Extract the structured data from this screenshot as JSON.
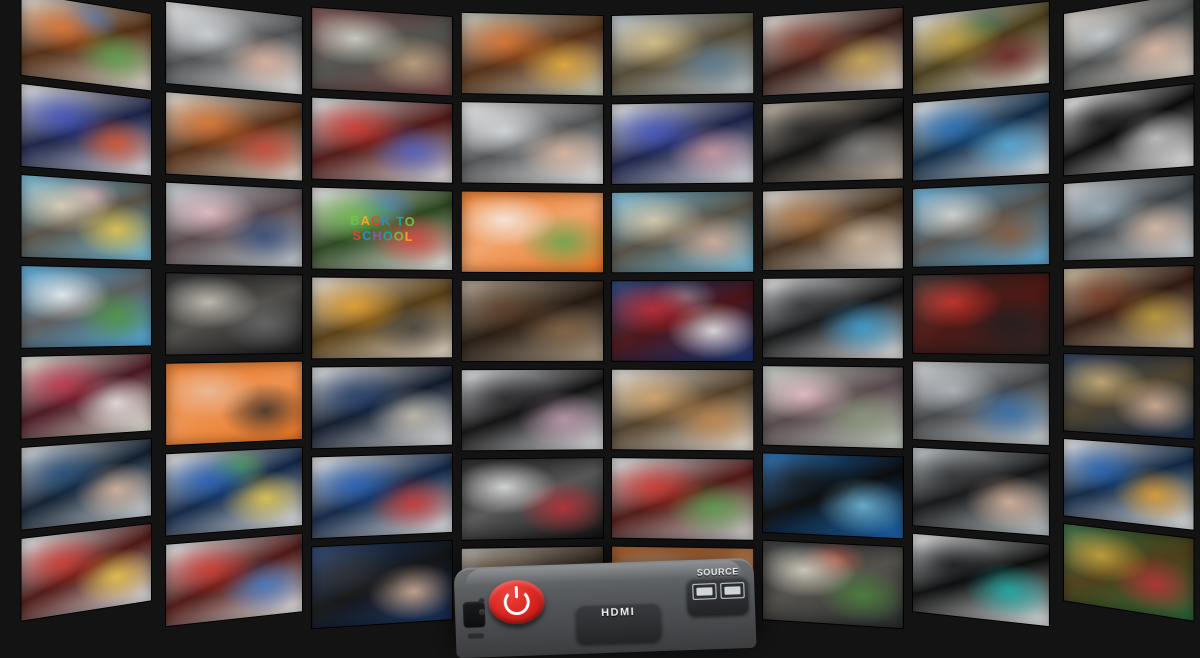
{
  "scene": {
    "title": "Video Wall",
    "description": "Curved multi-screen television video wall with remote control",
    "background_color": "#131313",
    "columns": 8,
    "rows": 8
  },
  "remote": {
    "name": "TV Remote Control",
    "body_color": "#595c5f",
    "power_button": {
      "label": "power",
      "color": "#d8231f"
    },
    "hdmi_button": {
      "label": "HDMI"
    },
    "source_button": {
      "label": "SOURCE"
    }
  },
  "screens": [
    [
      {
        "caption": "Wooden letter blocks spelling WORK",
        "colors": [
          "#e9e6df",
          "#e8762c",
          "#5aa84f",
          "#3f7fd0"
        ],
        "kind": "blocks-work"
      },
      {
        "caption": "Doctor measuring patient blood pressure",
        "colors": [
          "#f2f3f4",
          "#d8dde2",
          "#e8b9a3"
        ],
        "kind": "doctor-exam"
      },
      {
        "caption": "Hands holding fan of banknotes",
        "colors": [
          "#7a4a4a",
          "#dfe3d6",
          "#c9ae86"
        ],
        "kind": "cash-fan"
      },
      {
        "caption": "Banknotes with orange blister pill pack",
        "colors": [
          "#cfd3c4",
          "#e8762c",
          "#f2b43a"
        ],
        "kind": "money-pills"
      },
      {
        "caption": "Hands holding egg carton in store",
        "colors": [
          "#cbd4db",
          "#e4c98a",
          "#5b7d97"
        ],
        "kind": "eggs-carton"
      },
      {
        "caption": "Gavel with golden scales of justice",
        "colors": [
          "#efe9df",
          "#8a3b2a",
          "#d8b45a"
        ],
        "kind": "gavel-scales"
      },
      {
        "caption": "Coins, wax seal stamp and green book",
        "colors": [
          "#eceae6",
          "#c9a63c",
          "#6b1f1f",
          "#2e6a4a"
        ],
        "kind": "seal-book"
      },
      {
        "caption": "Washing hands at bathroom sink",
        "colors": [
          "#e6ded2",
          "#cfd6db",
          "#e9c0a8"
        ],
        "kind": "handwash"
      }
    ],
    [
      {
        "caption": "Gloved hand injecting tomato in lab",
        "colors": [
          "#f0f1f2",
          "#3f52c4",
          "#e4552c"
        ],
        "kind": "lab-tomato"
      },
      {
        "caption": "Tomatoes, eggs and test tubes on wood",
        "colors": [
          "#efe7dc",
          "#e8762c",
          "#d24a3a"
        ],
        "kind": "food-test"
      },
      {
        "caption": "Gloved hand with syringe and peppers",
        "colors": [
          "#eceff1",
          "#d8352c",
          "#4f63cc"
        ],
        "kind": "pepper-syringe"
      },
      {
        "caption": "Person paying online with credit card",
        "colors": [
          "#f4f5f6",
          "#e1e5e8",
          "#e5bda4"
        ],
        "kind": "online-pay"
      },
      {
        "caption": "Technician servicing air conditioner",
        "colors": [
          "#eef1f3",
          "#3f52c4",
          "#d8a0a8"
        ],
        "kind": "ac-service"
      },
      {
        "caption": "Vintage audio cassette tape on wood",
        "colors": [
          "#cdbfae",
          "#1c1c1c",
          "#8d8d8d"
        ],
        "kind": "cassette"
      },
      {
        "caption": "Blue steam clothes iron",
        "colors": [
          "#eef3f7",
          "#1f6fbd",
          "#57b0e0"
        ],
        "kind": "iron"
      },
      {
        "caption": "Close-up of piano keyboard keys",
        "colors": [
          "#ffffff",
          "#0d0d0d",
          "#cfcfcf"
        ],
        "kind": "piano"
      }
    ],
    [
      {
        "caption": "Piggy bank with sunglasses on beach",
        "colors": [
          "#7ec8e8",
          "#f0dfc0",
          "#f3d14a",
          "#f0b8c0"
        ],
        "kind": "piggy-beach"
      },
      {
        "caption": "Businessman holding a piggy bank",
        "colors": [
          "#cfd9e0",
          "#f2c7cf",
          "#2f4a7a"
        ],
        "kind": "piggy-hands"
      },
      {
        "caption": "Hands arranging BACK TO SCHOOL letters",
        "colors": [
          "#f6f6f5",
          "#6ec04a",
          "#e4403a",
          "#3f7fd0"
        ],
        "kind": "back-to-school",
        "text": [
          "BACK TO",
          "SCHOOL"
        ]
      },
      {
        "caption": "White smart plug adapter on orange",
        "colors": [
          "#f07a25",
          "#f4f5f6",
          "#5aa84f"
        ],
        "kind": "smart-plug",
        "bg": "#f07a25"
      },
      {
        "caption": "Starfish and seashells on sandy beach",
        "colors": [
          "#7ec8e8",
          "#ead9b6",
          "#e3b6a0"
        ],
        "kind": "beach-shells"
      },
      {
        "caption": "Hands protecting a small wooden house",
        "colors": [
          "#efe9e0",
          "#b5773f",
          "#d8c2a8"
        ],
        "kind": "house-hands"
      },
      {
        "caption": "Hand holding model house under blue sky",
        "colors": [
          "#67b6e3",
          "#e8e3da",
          "#8a5a3a"
        ],
        "kind": "house-sky"
      },
      {
        "caption": "Child using an asthma inhaler nebulizer",
        "colors": [
          "#d9dde0",
          "#9fb3c0",
          "#e8c4ad"
        ],
        "kind": "child-inhaler"
      }
    ],
    [
      {
        "caption": "Hand holding tree inside glass sphere",
        "colors": [
          "#56b2e8",
          "#ffffff",
          "#4e9a3e"
        ],
        "kind": "eco-tree"
      },
      {
        "caption": "E-reader tablet on stack of books",
        "colors": [
          "#1b1b1d",
          "#d9d4c8",
          "#6e6e70"
        ],
        "kind": "ereader"
      },
      {
        "caption": "Citrus fruits with juicer on table",
        "colors": [
          "#efe6d8",
          "#f0a52a",
          "#3f3f3f"
        ],
        "kind": "juicer"
      },
      {
        "caption": "Coffee beans in burlap sack and grinder",
        "colors": [
          "#b8a894",
          "#5a3a22",
          "#8a6a48"
        ],
        "kind": "coffee-beans"
      },
      {
        "caption": "American flag with Lady Justice statue",
        "colors": [
          "#1c3a7a",
          "#cf2a32",
          "#ffffff",
          "#9aa0a6"
        ],
        "kind": "flag-justice"
      },
      {
        "caption": "Contactless phone payment at terminal",
        "colors": [
          "#f0f2f4",
          "#2a2c2e",
          "#3aa7e0"
        ],
        "kind": "phone-pay"
      },
      {
        "caption": "Smartwatch paying on card terminal",
        "colors": [
          "#2b2522",
          "#d8352c",
          "#1f1f21"
        ],
        "kind": "watch-pay"
      },
      {
        "caption": "Judge gavel on desk with law books",
        "colors": [
          "#d8c8a8",
          "#7a3a22",
          "#c9a63c"
        ],
        "kind": "gavel-desk"
      }
    ],
    [
      {
        "caption": "Fresh raspberries in plastic cups",
        "colors": [
          "#eef3e6",
          "#c8324f",
          "#f4f4f2"
        ],
        "kind": "raspberries"
      },
      {
        "caption": "Hand holding house key on orange",
        "colors": [
          "#f07a25",
          "#e8c0a4",
          "#2a2a2a"
        ],
        "kind": "key-orange",
        "bg": "#f07a25"
      },
      {
        "caption": "Banknotes inside an open cash box",
        "colors": [
          "#eef1f3",
          "#1f3c6e",
          "#cfc8b8"
        ],
        "kind": "cashbox"
      },
      {
        "caption": "Person checking wristwatch with pills",
        "colors": [
          "#f0f2f4",
          "#1f1f21",
          "#c9a0b8"
        ],
        "kind": "watch-pills"
      },
      {
        "caption": "Ginger tabby cat close-up portrait",
        "colors": [
          "#f4efe6",
          "#dca96a",
          "#c98a4a"
        ],
        "kind": "cat"
      },
      {
        "caption": "Hand holding piggy bank before house",
        "colors": [
          "#cfd8d0",
          "#f2c7cf",
          "#8a9a7a"
        ],
        "kind": "piggy-house"
      },
      {
        "caption": "Stethoscope lying on laptop keyboard",
        "colors": [
          "#d8dcdf",
          "#b8bec4",
          "#2f6fb0"
        ],
        "kind": "stethoscope-laptop"
      },
      {
        "caption": "Hands playing an acoustic guitar",
        "colors": [
          "#1e3350",
          "#d8b87a",
          "#e8c0a4"
        ],
        "kind": "guitar"
      }
    ],
    [
      {
        "caption": "Finger pressing office copier panel",
        "colors": [
          "#dfe6ea",
          "#1f4a7a",
          "#e8c0a4"
        ],
        "kind": "copier"
      },
      {
        "caption": "Toy garbage truck with recycling bins",
        "colors": [
          "#f2f3f4",
          "#1f5fbd",
          "#f3d14a",
          "#4eb04a"
        ],
        "kind": "recycling-truck"
      },
      {
        "caption": "Toy truck and forklift on stock chart",
        "colors": [
          "#f4f5f6",
          "#1f5fbd",
          "#d8352c"
        ],
        "kind": "logistics-chart"
      },
      {
        "caption": "Laptop with miniature shopping cart",
        "colors": [
          "#141414",
          "#f2f3f4",
          "#c8323a"
        ],
        "kind": "ecommerce-cart"
      },
      {
        "caption": "Cutting vegetables on kitchen board",
        "colors": [
          "#eef1f3",
          "#d8352c",
          "#5aa84f"
        ],
        "kind": "kitchen-board"
      },
      {
        "caption": "Wireless internet router with antennas",
        "colors": [
          "#1f6fbd",
          "#101214",
          "#7ec8e8"
        ],
        "kind": "router"
      },
      {
        "caption": "Hands using a card payment terminal",
        "colors": [
          "#cfd8dc",
          "#2a2c2e",
          "#e8c0a4"
        ],
        "kind": "card-terminal"
      },
      {
        "caption": "Smartphone and tablet battery saving",
        "colors": [
          "#f4f5f6",
          "#1f62b8",
          "#f0a52a"
        ],
        "kind": "battery-saving"
      }
    ],
    [
      {
        "caption": "Vegetables and pot in bright kitchen",
        "colors": [
          "#eef1f3",
          "#d8352c",
          "#f3d14a"
        ],
        "kind": "kitchen-veg"
      },
      {
        "caption": "Hands crafting with colourful fabric",
        "colors": [
          "#f2f3f4",
          "#d8352c",
          "#3f7fd0"
        ],
        "kind": "crafting"
      },
      {
        "caption": "Blood pressure monitor cuff on arm",
        "colors": [
          "#1f3c6e",
          "#2a2c2e",
          "#e8c0a4"
        ],
        "kind": "blood-pressure"
      },
      {
        "caption": "Screen partly hidden behind remote",
        "colors": [
          "#efe6d8",
          "#c9a07a",
          "#8a5a3a"
        ],
        "kind": "hidden-left"
      },
      {
        "caption": "Screen partly hidden behind remote",
        "colors": [
          "#f07a25",
          "#f2f3f4",
          "#2a2c2e"
        ],
        "kind": "hidden-right",
        "bg": "#f07a25"
      },
      {
        "caption": "Platter of assorted sushi rolls",
        "colors": [
          "#2a2c2e",
          "#e8e2d2",
          "#4e8a3e",
          "#d8604a"
        ],
        "kind": "sushi"
      },
      {
        "caption": "Hands holding tablet with bar charts",
        "colors": [
          "#f2f3f4",
          "#101214",
          "#19b7b0"
        ],
        "kind": "tablet-charts"
      },
      {
        "caption": "Golden bauble on Christmas tree",
        "colors": [
          "#2e6a3a",
          "#d8a93a",
          "#c8323a"
        ],
        "kind": "christmas"
      }
    ]
  ]
}
